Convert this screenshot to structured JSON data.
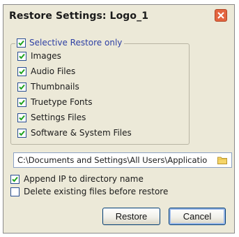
{
  "dialog": {
    "title": "Restore Settings: Logo_1"
  },
  "selective_restore": {
    "label": "Selective Restore only",
    "checked": true
  },
  "restore_options": [
    {
      "label": "Images",
      "checked": true
    },
    {
      "label": "Audio Files",
      "checked": true
    },
    {
      "label": "Thumbnails",
      "checked": true
    },
    {
      "label": "Truetype Fonts",
      "checked": true
    },
    {
      "label": "Settings Files",
      "checked": true
    },
    {
      "label": "Software & System Files",
      "checked": true
    }
  ],
  "path": {
    "value": "C:\\Documents and Settings\\All Users\\Applicatio"
  },
  "options": {
    "append_ip_label": "Append IP to directory name",
    "append_ip_checked": true,
    "delete_existing_label": "Delete existing files before restore",
    "delete_existing_checked": false
  },
  "buttons": {
    "restore_label": "Restore",
    "cancel_label": "Cancel"
  },
  "colors": {
    "window_bg": "#ece9d8",
    "check_green": "#1fa31f",
    "close_red": "#e3653f"
  },
  "icons": {
    "close": "close-icon",
    "folder": "folder-icon",
    "check": "checkmark-icon"
  }
}
